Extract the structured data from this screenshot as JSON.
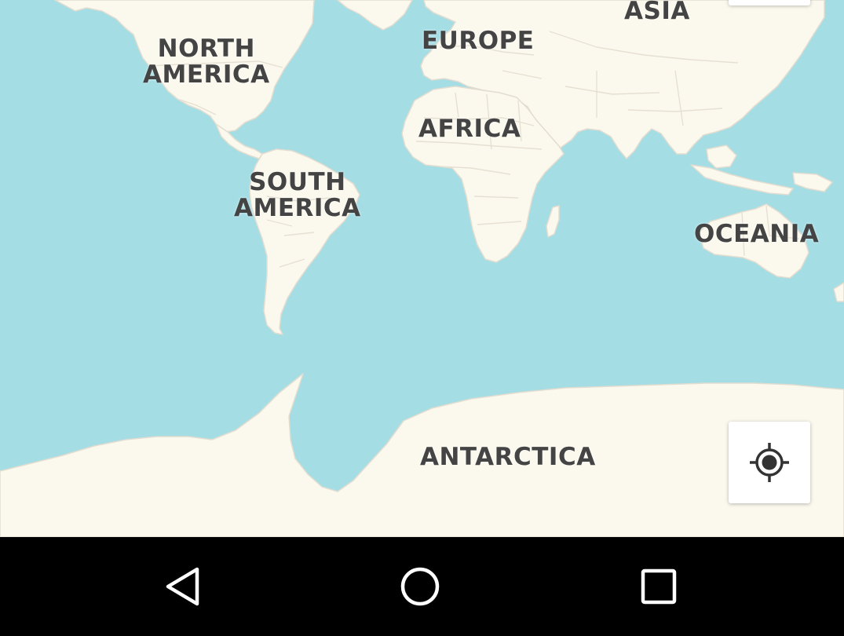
{
  "map": {
    "colors": {
      "water": "#a5dde5",
      "land": "#fbf9ee",
      "border": "#e3ddd0",
      "label": "#444444"
    },
    "labels": {
      "north_america": [
        "NORTH",
        "AMERICA"
      ],
      "europe": "EUROPE",
      "asia": "ASIA",
      "africa": "AFRICA",
      "south_america": [
        "SOUTH",
        "AMERICA"
      ],
      "oceania": "OCEANIA",
      "antarctica": "ANTARCTICA"
    }
  },
  "controls": {
    "locate_icon": "my-location-icon"
  },
  "navbar": {
    "back_icon": "back-triangle-icon",
    "home_icon": "home-circle-icon",
    "recents_icon": "recents-square-icon"
  }
}
